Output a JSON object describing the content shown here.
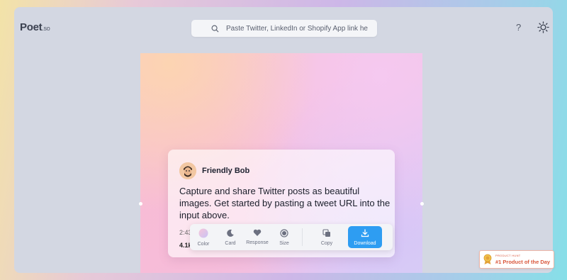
{
  "app": {
    "logo": "Poet",
    "logo_suffix": ".so",
    "search_placeholder": "Paste Twitter, LinkedIn or Shopify App link here",
    "help_label": "?"
  },
  "card": {
    "author_name": "Friendly Bob",
    "tweet_text": "Capture and share Twitter posts as beautiful images. Get started by pasting a tweet URL into the input above.",
    "time_partial": "2:43",
    "stat_partial": "4.1k"
  },
  "toolbar": {
    "color_label": "Color",
    "card_label": "Card",
    "response_label": "Response",
    "size_label": "Size",
    "copy_label": "Copy",
    "download_label": "Download"
  },
  "badge": {
    "small": "PRODUCT HUNT",
    "title": "#1 Product of the Day"
  },
  "colors": {
    "download_bg": "#2e9df2",
    "badge_text": "#d9573c"
  }
}
